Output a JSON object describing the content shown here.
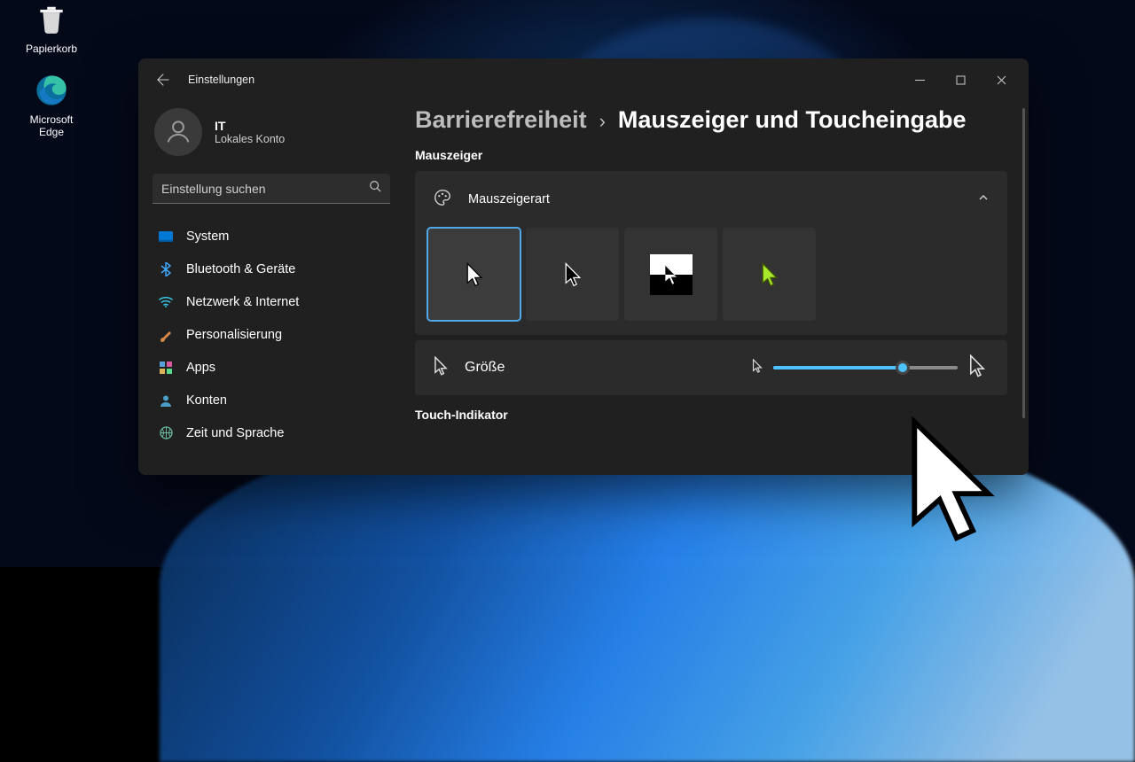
{
  "desktop": {
    "icons": [
      "Papierkorb",
      "Microsoft Edge"
    ]
  },
  "window": {
    "title": "Einstellungen",
    "account": {
      "name": "IT",
      "sub": "Lokales Konto"
    },
    "search_placeholder": "Einstellung suchen",
    "nav": [
      {
        "label": "System",
        "icon": "system"
      },
      {
        "label": "Bluetooth & Geräte",
        "icon": "bluetooth"
      },
      {
        "label": "Netzwerk & Internet",
        "icon": "wifi"
      },
      {
        "label": "Personalisierung",
        "icon": "brush"
      },
      {
        "label": "Apps",
        "icon": "apps"
      },
      {
        "label": "Konten",
        "icon": "person"
      },
      {
        "label": "Zeit und Sprache",
        "icon": "globe"
      }
    ],
    "breadcrumb": {
      "parent": "Barrierefreiheit",
      "current": "Mauszeiger und Toucheingabe"
    },
    "sections": {
      "mouse_pointer": "Mauszeiger",
      "pointer_style": "Mauszeigerart",
      "size": "Größe",
      "touch_indicator": "Touch-Indikator"
    }
  }
}
